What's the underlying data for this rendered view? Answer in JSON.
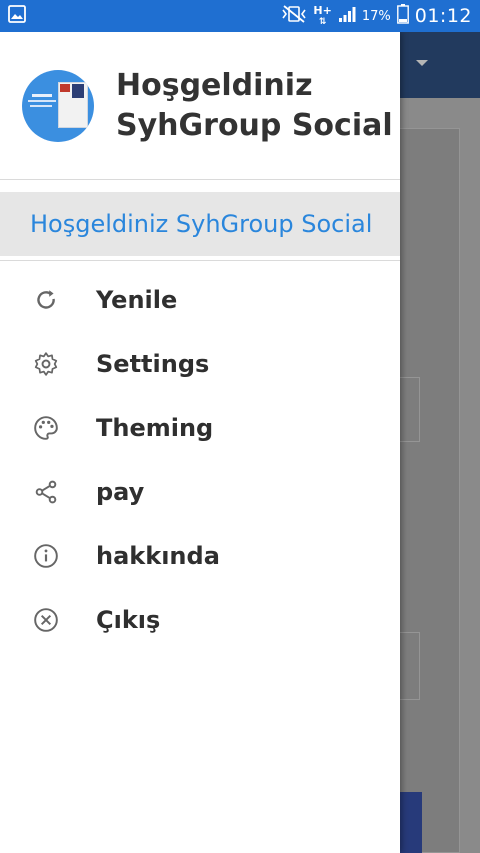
{
  "status_bar": {
    "battery_percent": "17%",
    "time": "01:12",
    "network_type": "H+"
  },
  "drawer": {
    "header": {
      "title": "Hoşgeldiniz SyhGroup Social"
    },
    "active_item": {
      "label": "Hoşgeldiniz SyhGroup Social"
    },
    "items": [
      {
        "label": "Yenile",
        "icon": "refresh-icon"
      },
      {
        "label": "Settings",
        "icon": "gear-icon"
      },
      {
        "label": "Theming",
        "icon": "palette-icon"
      },
      {
        "label": "pay",
        "icon": "share-icon"
      },
      {
        "label": "hakkında",
        "icon": "info-icon"
      },
      {
        "label": "Çıkış",
        "icon": "close-circle-icon"
      }
    ]
  },
  "colors": {
    "status_bar": "#1f6fd1",
    "accent": "#2a86dc",
    "app_toolbar": "#223a5e"
  }
}
